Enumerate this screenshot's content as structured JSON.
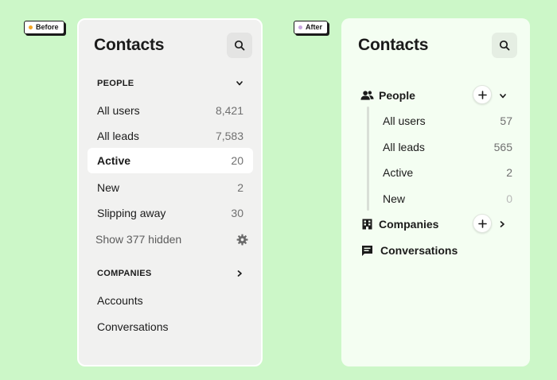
{
  "tags": {
    "before": {
      "label": "Before",
      "dot_color": "#f5a623"
    },
    "after": {
      "label": "After",
      "dot_color": "#c9a6e0"
    }
  },
  "before": {
    "title": "Contacts",
    "people_header": "PEOPLE",
    "people_items": [
      {
        "label": "All users",
        "count": "8,421"
      },
      {
        "label": "All leads",
        "count": "7,583"
      },
      {
        "label": "Active",
        "count": "20"
      },
      {
        "label": "New",
        "count": "2"
      },
      {
        "label": "Slipping away",
        "count": "30"
      }
    ],
    "show_hidden": "Show 377 hidden",
    "companies_header": "COMPANIES",
    "other_items": [
      "Accounts",
      "Conversations"
    ]
  },
  "after": {
    "title": "Contacts",
    "people_label": "People",
    "people_items": [
      {
        "label": "All users",
        "count": "57"
      },
      {
        "label": "All leads",
        "count": "565"
      },
      {
        "label": "Active",
        "count": "2"
      },
      {
        "label": "New",
        "count": "0"
      }
    ],
    "companies_label": "Companies",
    "conversations_label": "Conversations"
  },
  "icons": {
    "search": "search-icon",
    "chevron_down": "chevron-down-icon",
    "chevron_right": "chevron-right-icon",
    "gear": "gear-icon",
    "people": "people-icon",
    "building": "building-icon",
    "chat": "chat-icon",
    "plus": "plus-icon"
  },
  "colors": {
    "background": "#ccf7c8",
    "before_panel": "#f1f1f0",
    "after_panel": "#f4fef2"
  }
}
